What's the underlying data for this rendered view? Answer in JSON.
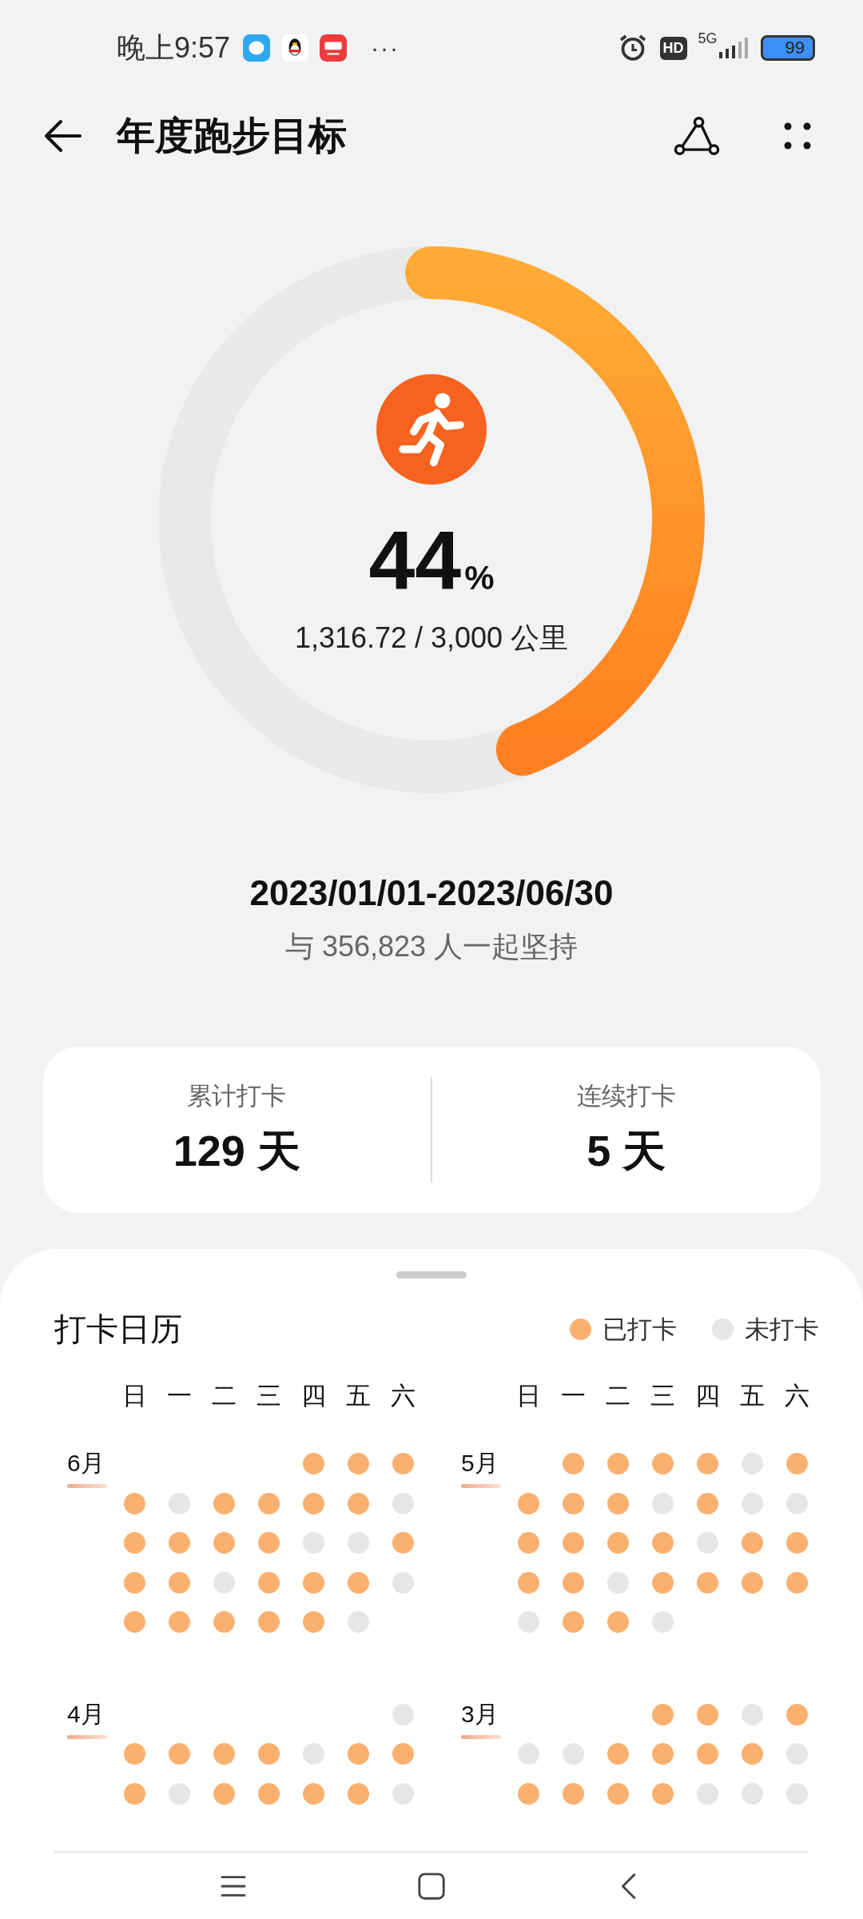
{
  "status_bar": {
    "time": "晚上9:57",
    "more": "···",
    "hd": "HD",
    "network": "5G",
    "battery": "99"
  },
  "app_bar": {
    "title": "年度跑步目标"
  },
  "goal": {
    "percent": "44",
    "percent_sign": "%",
    "distance": "1,316.72 / 3,000 公里",
    "date_range": "2023/01/01-2023/06/30",
    "participants": "与 356,823 人一起坚持"
  },
  "stats": [
    {
      "label": "累计打卡",
      "value": "129 天"
    },
    {
      "label": "连续打卡",
      "value": "5 天"
    }
  ],
  "calendar": {
    "title": "打卡日历",
    "legend": [
      {
        "label": "已打卡",
        "color": "#fbb06f"
      },
      {
        "label": "未打卡",
        "color": "#e6e6e6"
      }
    ],
    "columns": [
      {
        "weekdays": [
          "日",
          "一",
          "二",
          "三",
          "四",
          "五",
          "六"
        ],
        "months": [
          {
            "label": "6月",
            "weeks": [
              {
                "kind": "leading",
                "days": [
                  true,
                  true,
                  true
                ]
              },
              {
                "kind": "full",
                "days": [
                  true,
                  false,
                  true,
                  true,
                  true,
                  true,
                  false
                ]
              },
              {
                "kind": "full",
                "days": [
                  true,
                  true,
                  true,
                  true,
                  false,
                  false,
                  true
                ]
              },
              {
                "kind": "full",
                "days": [
                  true,
                  true,
                  false,
                  true,
                  true,
                  true,
                  false
                ]
              },
              {
                "kind": "trailing",
                "days": [
                  true,
                  true,
                  true,
                  true,
                  true,
                  false
                ]
              }
            ]
          },
          {
            "label": "4月",
            "weeks": [
              {
                "kind": "leading",
                "days": [
                  false
                ]
              },
              {
                "kind": "full",
                "days": [
                  true,
                  true,
                  true,
                  true,
                  false,
                  true,
                  true
                ]
              },
              {
                "kind": "full",
                "days": [
                  true,
                  false,
                  true,
                  true,
                  true,
                  true,
                  false
                ]
              }
            ]
          }
        ]
      },
      {
        "weekdays": [
          "日",
          "一",
          "二",
          "三",
          "四",
          "五",
          "六"
        ],
        "months": [
          {
            "label": "5月",
            "weeks": [
              {
                "kind": "leading",
                "days": [
                  true,
                  true,
                  true,
                  true,
                  false,
                  true
                ]
              },
              {
                "kind": "full",
                "days": [
                  true,
                  true,
                  true,
                  false,
                  true,
                  false,
                  false
                ]
              },
              {
                "kind": "full",
                "days": [
                  true,
                  true,
                  true,
                  true,
                  false,
                  true,
                  true
                ]
              },
              {
                "kind": "full",
                "days": [
                  true,
                  true,
                  false,
                  true,
                  true,
                  true,
                  true
                ]
              },
              {
                "kind": "trailing",
                "days": [
                  false,
                  true,
                  true,
                  false
                ]
              }
            ]
          },
          {
            "label": "3月",
            "weeks": [
              {
                "kind": "leading",
                "days": [
                  true,
                  true,
                  false,
                  true
                ]
              },
              {
                "kind": "full",
                "days": [
                  false,
                  false,
                  true,
                  true,
                  true,
                  true,
                  false
                ]
              },
              {
                "kind": "full",
                "days": [
                  true,
                  true,
                  true,
                  true,
                  false,
                  false,
                  false
                ]
              }
            ]
          }
        ]
      }
    ]
  }
}
